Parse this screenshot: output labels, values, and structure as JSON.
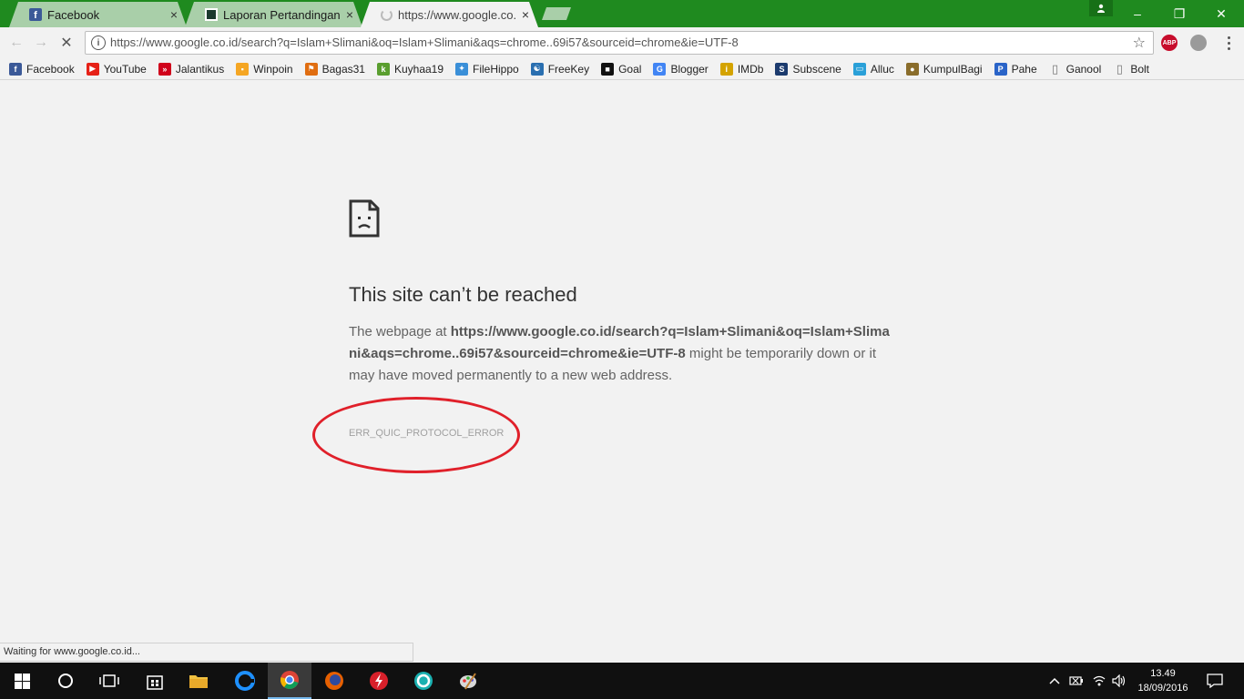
{
  "tabs": [
    {
      "label": "Facebook",
      "close": "×"
    },
    {
      "label": "Laporan Pertandingan Le",
      "close": "×"
    },
    {
      "label": "https://www.google.co.id",
      "close": "×"
    }
  ],
  "window": {
    "minimize": "–",
    "restore": "❐",
    "close": "✕"
  },
  "toolbar": {
    "back": "←",
    "forward": "→",
    "stop": "✕",
    "url": "https://www.google.co.id/search?q=Islam+Slimani&oq=Islam+Slimani&aqs=chrome..69i57&sourceid=chrome&ie=UTF-8",
    "info": "i",
    "star": "☆",
    "abp_label": "ABP"
  },
  "bookmarks": [
    {
      "label": "Facebook",
      "icon": "facebook-icon",
      "color": "#3b5998",
      "glyph": "f"
    },
    {
      "label": "YouTube",
      "icon": "youtube-icon",
      "color": "#e62117",
      "glyph": "▶"
    },
    {
      "label": "Jalantikus",
      "icon": "jalantikus-icon",
      "color": "#d0021b",
      "glyph": "»"
    },
    {
      "label": "Winpoin",
      "icon": "winpoin-icon",
      "color": "#f5a623",
      "glyph": "▪"
    },
    {
      "label": "Bagas31",
      "icon": "bagas31-icon",
      "color": "#e06d10",
      "glyph": "⚑"
    },
    {
      "label": "Kuyhaa19",
      "icon": "kuyhaa-icon",
      "color": "#5a9e2f",
      "glyph": "k"
    },
    {
      "label": "FileHippo",
      "icon": "filehippo-icon",
      "color": "#3a8fd8",
      "glyph": "✦"
    },
    {
      "label": "FreeKey",
      "icon": "freekey-icon",
      "color": "#2a6fb0",
      "glyph": "☯"
    },
    {
      "label": "Goal",
      "icon": "goal-icon",
      "color": "#111111",
      "glyph": "■"
    },
    {
      "label": "Blogger",
      "icon": "google-icon",
      "color": "#4285f4",
      "glyph": "G"
    },
    {
      "label": "IMDb",
      "icon": "imdb-icon",
      "color": "#d4a300",
      "glyph": "i"
    },
    {
      "label": "Subscene",
      "icon": "subscene-icon",
      "color": "#1c3b6e",
      "glyph": "S"
    },
    {
      "label": "Alluc",
      "icon": "alluc-icon",
      "color": "#2aa0d8",
      "glyph": "▭"
    },
    {
      "label": "KumpulBagi",
      "icon": "kumpulbagi-icon",
      "color": "#8a6d2b",
      "glyph": "●"
    },
    {
      "label": "Pahe",
      "icon": "pahe-icon",
      "color": "#2a64c8",
      "glyph": "P"
    },
    {
      "label": "Ganool",
      "icon": "page-icon",
      "color": "#777777",
      "glyph": "▯"
    },
    {
      "label": "Bolt",
      "icon": "page-icon",
      "color": "#777777",
      "glyph": "▯"
    }
  ],
  "error": {
    "title": "This site can’t be reached",
    "body_prefix": "The webpage at ",
    "body_url": "https://www.google.co.id/search?q=Islam+Slimani&oq=Islam+Slimani&aqs=chrome..69i57&sourceid=chrome&ie=UTF-8",
    "body_suffix": " might be temporarily down or it may have moved permanently to a new web address.",
    "code": "ERR_QUIC_PROTOCOL_ERROR"
  },
  "status_bar": "Waiting for www.google.co.id...",
  "taskbar": {
    "clock_time": "13.49",
    "clock_date": "18/09/2016"
  },
  "colors": {
    "titlebar": "#1f8a1f",
    "highlight": "#e0202a"
  }
}
